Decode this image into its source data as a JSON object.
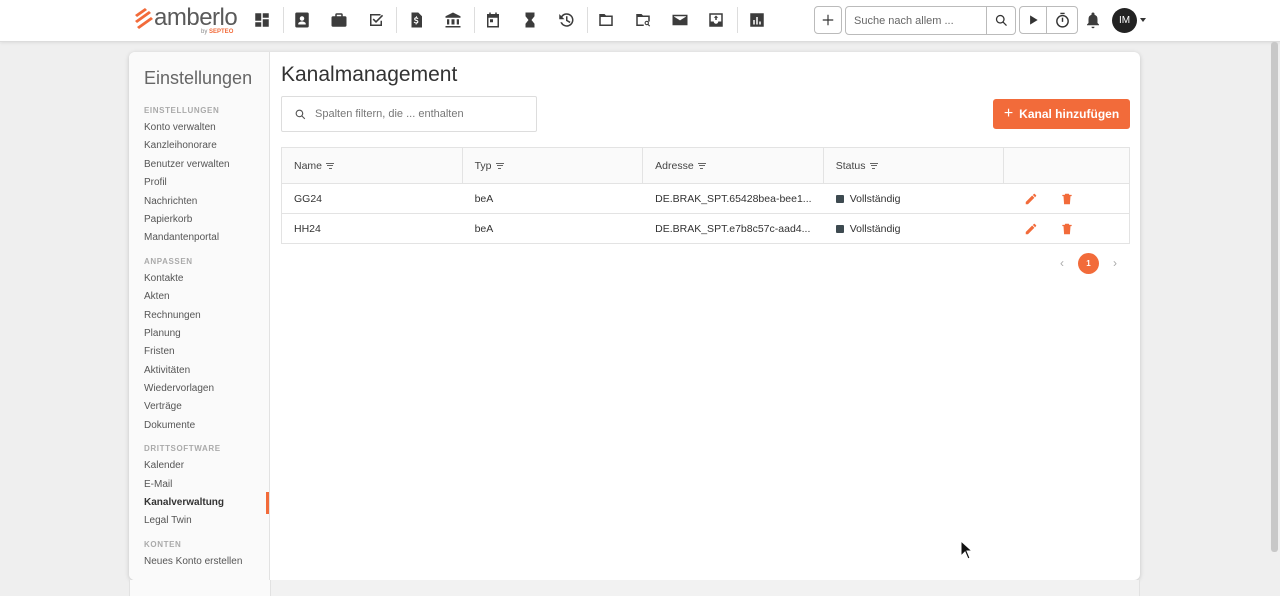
{
  "app": {
    "logo_text": "amberlo",
    "logo_sub_prefix": "by",
    "logo_sub_brand": "SEPTEO",
    "brand_color": "#f26b3a"
  },
  "topbar": {
    "icons": [
      "dashboard-icon",
      "contacts-icon",
      "briefcase-icon",
      "tasks-check-icon",
      "invoice-dollar-icon",
      "bank-icon",
      "calendar-icon",
      "hourglass-icon",
      "history-icon",
      "folder-icon",
      "folder-search-icon",
      "mail-icon",
      "inbox-icon",
      "reports-chart-icon"
    ],
    "search_placeholder": "Suche nach allem ...",
    "avatar_initials": "IM"
  },
  "sidebar": {
    "title": "Einstellungen",
    "sections": [
      {
        "heading": "EINSTELLUNGEN",
        "items": [
          "Konto verwalten",
          "Kanzleihonorare",
          "Benutzer verwalten",
          "Profil",
          "Nachrichten",
          "Papierkorb",
          "Mandantenportal"
        ]
      },
      {
        "heading": "ANPASSEN",
        "items": [
          "Kontakte",
          "Akten",
          "Rechnungen",
          "Planung",
          "Fristen",
          "Aktivitäten",
          "Wiedervorlagen",
          "Verträge",
          "Dokumente"
        ]
      },
      {
        "heading": "DRITTSOFTWARE",
        "items": [
          "Kalender",
          "E-Mail",
          "Kanalverwaltung",
          "Legal Twin"
        ]
      },
      {
        "heading": "KONTEN",
        "items": [
          "Neues Konto erstellen"
        ]
      }
    ],
    "active_item": "Kanalverwaltung"
  },
  "main": {
    "title": "Kanalmanagement",
    "filter_placeholder": "Spalten filtern, die ... enthalten",
    "add_button": "Kanal hinzufügen",
    "table": {
      "columns": [
        "Name",
        "Typ",
        "Adresse",
        "Status"
      ],
      "rows": [
        {
          "name": "GG24",
          "typ": "beA",
          "adresse": "DE.BRAK_SPT.65428bea-bee1...",
          "status": "Vollständig"
        },
        {
          "name": "HH24",
          "typ": "beA",
          "adresse": "DE.BRAK_SPT.e7b8c57c-aad4...",
          "status": "Vollständig"
        }
      ]
    },
    "pagination": {
      "prev": "‹",
      "current": "1",
      "next": "›"
    }
  }
}
